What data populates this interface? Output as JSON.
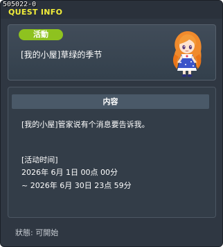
{
  "window": {
    "id_label": "505022-0",
    "title": "QUEST INFO"
  },
  "header": {
    "badge": "活動",
    "quest_name": "[我的小屋]草绿的季节"
  },
  "content": {
    "section_title": "内容",
    "description": "[我的小屋]管家说有个消息要告诉我。",
    "time_label": "[活动时间]",
    "time_start": "2026年 6月 1日 00点 00分",
    "time_end": "~ 2026年 6月 30日 23点 59分"
  },
  "status": {
    "label": "狀態:",
    "value": "可開始"
  },
  "icons": {
    "npc": "npc-portrait-icon"
  },
  "colors": {
    "title": "#f2ee3a",
    "badge": "#8ec21f",
    "panel": "#333d48"
  }
}
